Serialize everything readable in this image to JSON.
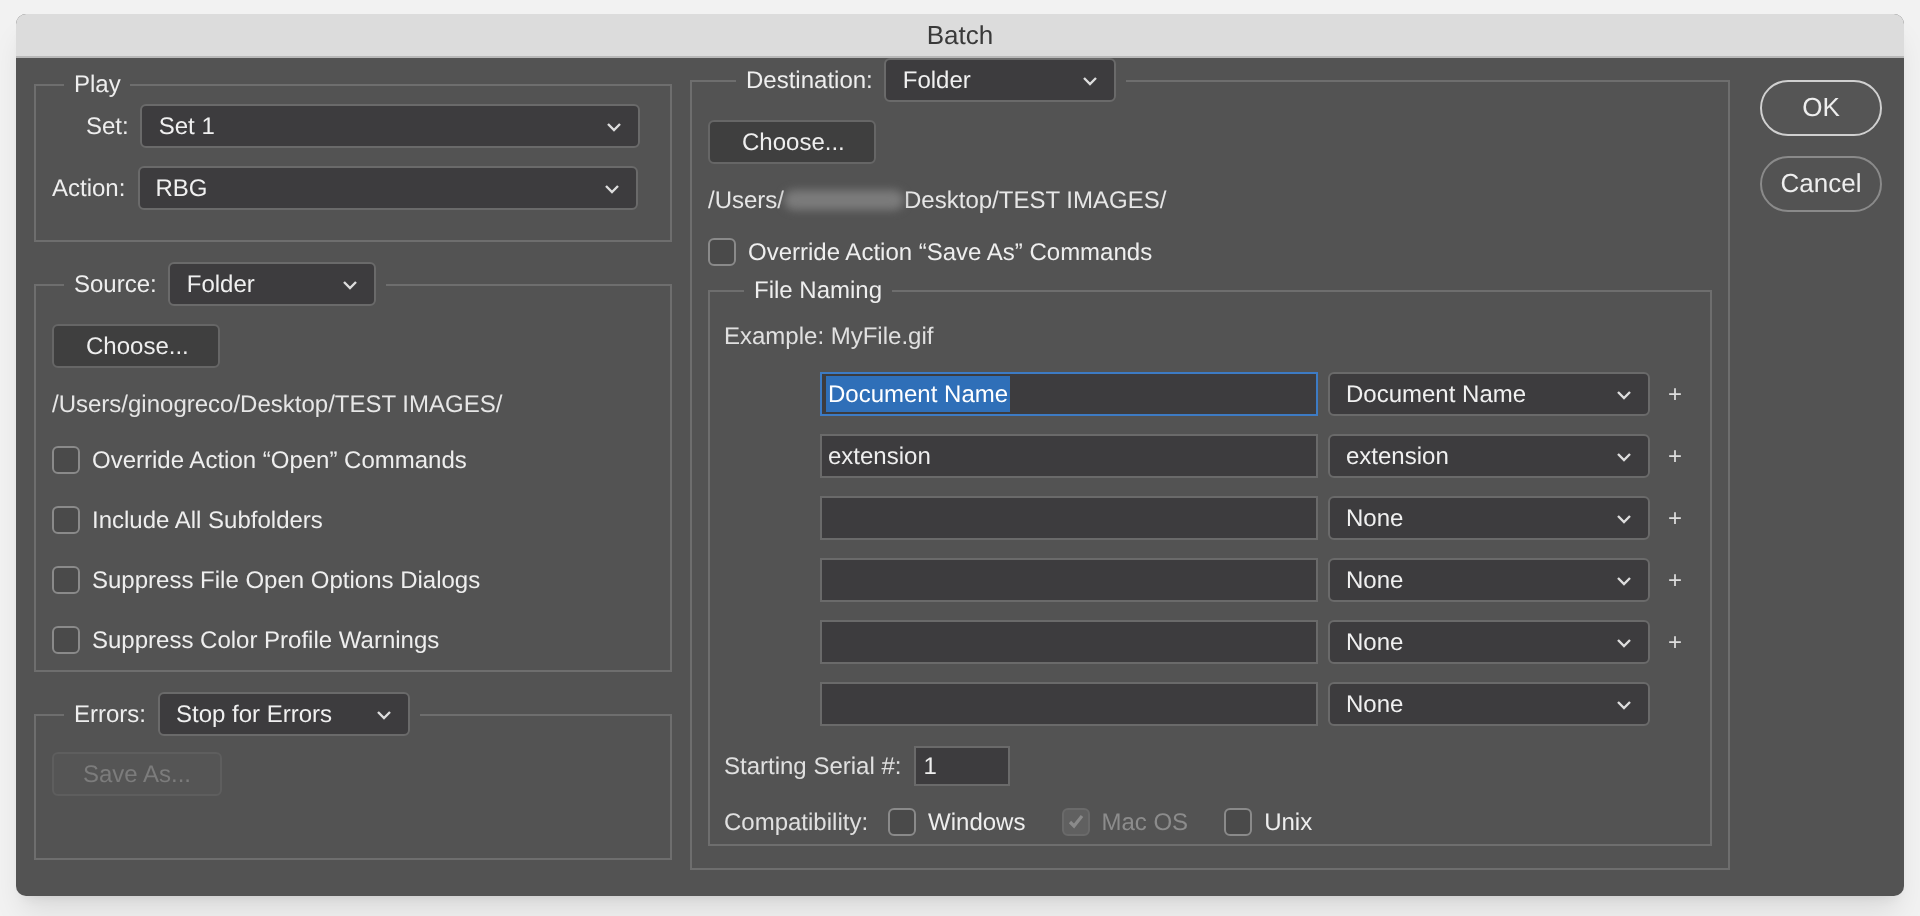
{
  "window": {
    "title": "Batch"
  },
  "play": {
    "legend": "Play",
    "set_label": "Set:",
    "set_value": "Set 1",
    "action_label": "Action:",
    "action_value": "RBG"
  },
  "source": {
    "label": "Source:",
    "value": "Folder",
    "choose": "Choose...",
    "path": "/Users/ginogreco/Desktop/TEST IMAGES/",
    "options": [
      {
        "label": "Override Action “Open” Commands",
        "checked": false
      },
      {
        "label": "Include All Subfolders",
        "checked": false
      },
      {
        "label": "Suppress File Open Options Dialogs",
        "checked": false
      },
      {
        "label": "Suppress Color Profile Warnings",
        "checked": false
      }
    ]
  },
  "errors": {
    "label": "Errors:",
    "value": "Stop for Errors",
    "save_as": {
      "label": "Save As...",
      "disabled": true
    }
  },
  "destination": {
    "label": "Destination:",
    "value": "Folder",
    "choose": "Choose...",
    "path_start": "/Users/",
    "path_end": "Desktop/TEST IMAGES/",
    "override": {
      "label": "Override Action “Save As” Commands",
      "checked": false
    },
    "file_naming": {
      "legend": "File Naming",
      "example": "Example: MyFile.gif",
      "rows": [
        {
          "value": "Document Name",
          "selected": true,
          "token": "Document Name",
          "plus": true
        },
        {
          "value": "extension",
          "selected": false,
          "token": "extension",
          "plus": true
        },
        {
          "value": "",
          "selected": false,
          "token": "None",
          "plus": true
        },
        {
          "value": "",
          "selected": false,
          "token": "None",
          "plus": true
        },
        {
          "value": "",
          "selected": false,
          "token": "None",
          "plus": true
        },
        {
          "value": "",
          "selected": false,
          "token": "None",
          "plus": false
        }
      ],
      "plus_sign": "+",
      "serial_label": "Starting Serial #:",
      "serial_value": "1",
      "compat_label": "Compatibility:",
      "compat": [
        {
          "label": "Windows",
          "checked": false,
          "disabled": false
        },
        {
          "label": "Mac OS",
          "checked": true,
          "disabled": true
        },
        {
          "label": "Unix",
          "checked": false,
          "disabled": false
        }
      ]
    }
  },
  "buttons": [
    {
      "label": "OK",
      "default": true
    },
    {
      "label": "Cancel",
      "default": false
    }
  ]
}
